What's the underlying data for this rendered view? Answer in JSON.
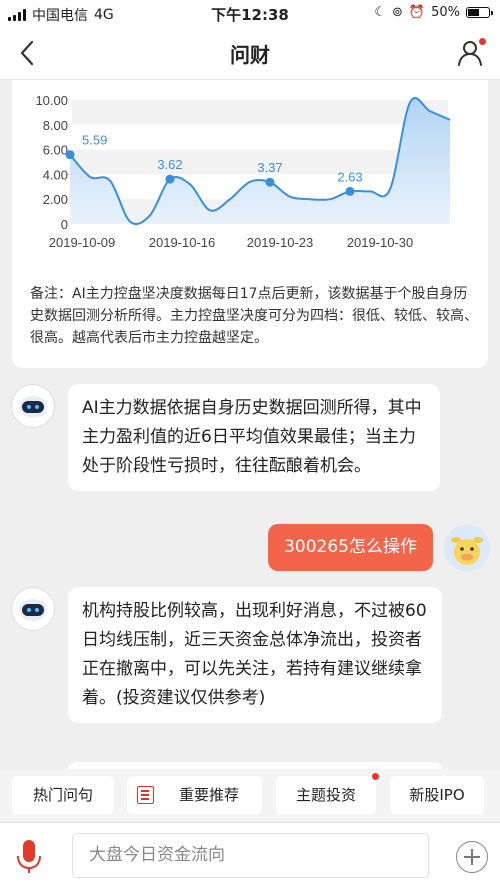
{
  "status_bar": {
    "carrier": "中国电信",
    "network": "4G",
    "time": "下午12:38",
    "battery": "50%"
  },
  "nav": {
    "title": "问财",
    "back_icon": "chevron-left-icon",
    "user_icon": "user-icon"
  },
  "chart_data": {
    "type": "area",
    "y_ticks": [
      "10.00",
      "8.00",
      "6.00",
      "4.00",
      "2.00",
      "0"
    ],
    "ylim": [
      0,
      10
    ],
    "x_ticks": [
      "2019-10-09",
      "2019-10-16",
      "2019-10-23",
      "2019-10-30"
    ],
    "x": [
      0,
      1,
      2,
      3,
      4,
      5,
      6,
      7,
      8,
      9,
      10,
      11,
      12,
      13,
      14,
      15,
      16,
      17,
      18,
      19,
      20,
      21,
      22,
      23,
      24,
      25,
      26,
      27
    ],
    "values": [
      5.59,
      3.8,
      3.5,
      0.2,
      0.7,
      3.62,
      3.2,
      1.1,
      2.0,
      3.4,
      3.37,
      2.2,
      2.0,
      2.0,
      2.63,
      2.63,
      2.8,
      9.8,
      9.1,
      8.4
    ],
    "labeled_points": [
      {
        "value": 5.59,
        "label": "5.59"
      },
      {
        "value": 3.62,
        "label": "3.62"
      },
      {
        "value": 3.37,
        "label": "3.37"
      },
      {
        "value": 2.63,
        "label": "2.63"
      }
    ],
    "line_color": "#3b8fd9",
    "grid": true
  },
  "chart_note": "备注：AI主力控盘坚决度数据每日17点后更新，该数据基于个股自身历史数据回测分析所得。主力控盘坚决度可分为四档：很低、较低、较高、很高。越高代表后市主力控盘越坚定。",
  "messages": [
    {
      "from": "bot",
      "text": "AI主力数据依据自身历史数据回测所得，其中主力盈利值的近6日平均值效果最佳；当主力处于阶段性亏损时，往往酝酿着机会。"
    },
    {
      "from": "user",
      "text": "300265怎么操作"
    },
    {
      "from": "bot",
      "text": "机构持股比例较高，出现利好消息，不过被60日均线压制，近三天资金总体净流出，投资者正在撤离中，可以先关注，若持有建议继续拿着。(投资建议仅供参考)"
    }
  ],
  "quick_tabs": [
    {
      "label": "热门问句"
    },
    {
      "label": "重要推荐",
      "icon": "document-icon"
    },
    {
      "label": "主题投资",
      "badge_dot": true
    },
    {
      "label": "新股IPO"
    }
  ],
  "input": {
    "placeholder": "大盘今日资金流向",
    "mic_icon": "microphone-icon",
    "plus_icon": "plus-icon"
  },
  "colors": {
    "accent": "#e8382e",
    "user_bubble": "#f2654a",
    "chart_line": "#3b8fd9"
  }
}
